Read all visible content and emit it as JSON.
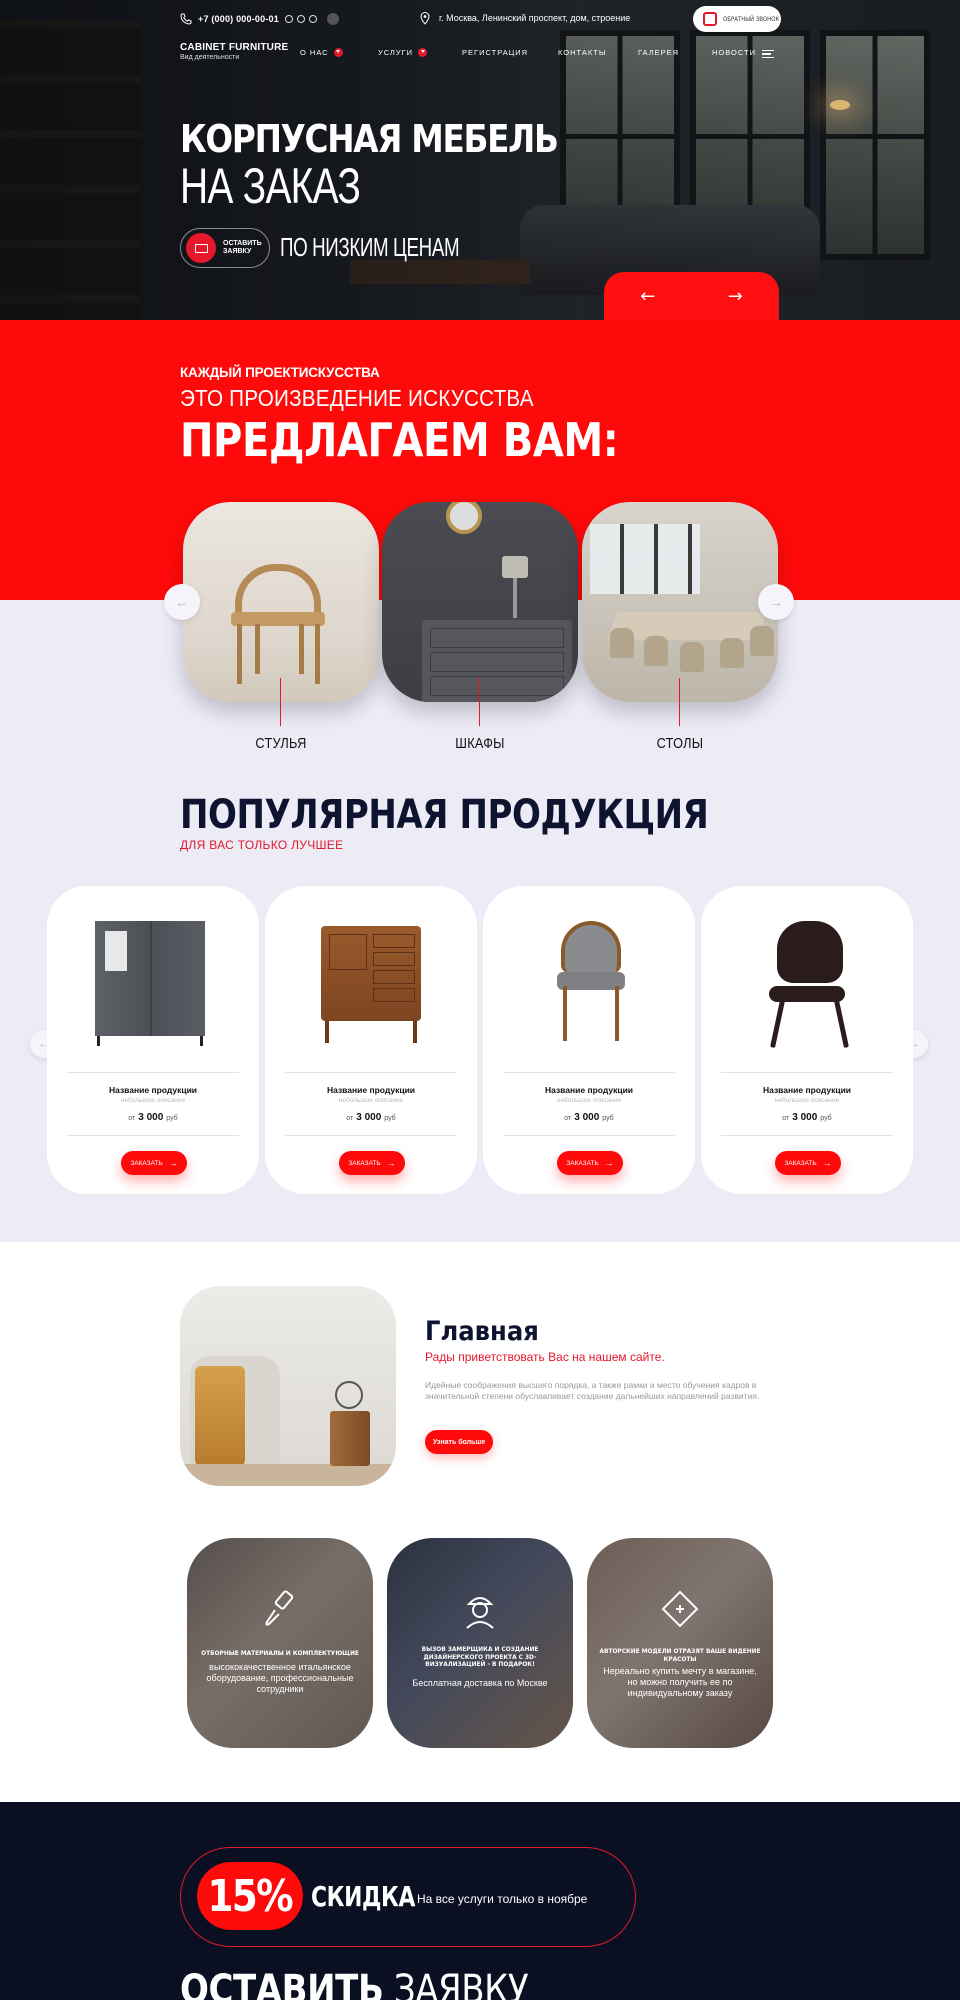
{
  "topbar": {
    "phone": "+7 (000) 000-00-01",
    "address": "г. Москва, Ленинский проспект, дом, строение",
    "callback_label": "ОБРАТНЫЙ ЗВОНОК"
  },
  "logo": {
    "name": "CABINET FURNITURE",
    "tagline": "Вид деятельности"
  },
  "nav": [
    {
      "label": "О НАС",
      "dropdown": true
    },
    {
      "label": "УСЛУГИ",
      "dropdown": true
    },
    {
      "label": "РЕГИСТРАЦИЯ",
      "dropdown": false
    },
    {
      "label": "КОНТАКТЫ",
      "dropdown": false
    },
    {
      "label": "ГАЛЕРЕЯ",
      "dropdown": false
    },
    {
      "label": "НОВОСТИ",
      "dropdown": false
    }
  ],
  "hero": {
    "title_line1": "КОРПУСНАЯ МЕБЕЛЬ",
    "title_line2": "НА ЗАКАЗ",
    "request_button": "ОСТАВИТЬ ЗАЯВКУ",
    "subtitle": "ПО НИЗКИМ ЦЕНАМ",
    "prev_arrow": "←",
    "next_arrow": "→"
  },
  "offer": {
    "kicker": "КАЖДЫЙ ПРОЕКТИСКУССТВА",
    "line2": "ЭТО ПРОИЗВЕДЕНИЕ ИСКУССТВА",
    "title": "ПРЕДЛАГАЕМ ВАМ:",
    "categories": [
      {
        "label": "СТУЛЬЯ"
      },
      {
        "label": "ШКАФЫ"
      },
      {
        "label": "СТОЛЫ"
      }
    ],
    "prev_arrow": "←",
    "next_arrow": "→"
  },
  "popular": {
    "title": "ПОПУЛЯРНАЯ ПРОДУКЦИЯ",
    "subtitle": "ДЛЯ ВАС ТОЛЬКО ЛУЧШЕЕ",
    "prev_arrow": "←",
    "next_arrow": "→",
    "products": [
      {
        "name": "Название продукции",
        "description": "небольшое описание",
        "price_prefix": "от",
        "price": "3 000",
        "currency": "руб",
        "order_label": "ЗАКАЗАТЬ"
      },
      {
        "name": "Название продукции",
        "description": "небольшое описание",
        "price_prefix": "от",
        "price": "3 000",
        "currency": "руб",
        "order_label": "ЗАКАЗАТЬ"
      },
      {
        "name": "Название продукции",
        "description": "небольшое описание",
        "price_prefix": "от",
        "price": "3 000",
        "currency": "руб",
        "order_label": "ЗАКАЗАТЬ"
      },
      {
        "name": "Название продукции",
        "description": "небольшое описание",
        "price_prefix": "от",
        "price": "3 000",
        "currency": "руб",
        "order_label": "ЗАКАЗАТЬ"
      }
    ]
  },
  "about": {
    "title": "Главная",
    "subtitle": "Рады приветствовать Вас на нашем сайте.",
    "text": "Идейные соображения высшего порядка, а также рамки и место обучения кадров в значительной степени обуславливает создание дальнейших направлений развития.",
    "button": "Узнать больше"
  },
  "features": [
    {
      "title": "ОТБОРНЫЕ МАТЕРИАЛЫ И КОМПЛЕКТУЮЩИЕ",
      "description": "высококачественное итальянское оборудование, профессиональные сотрудники",
      "icon": "brush-icon"
    },
    {
      "title": "ВЫЗОВ ЗАМЕРЩИКА И СОЗДАНИЕ ДИЗАЙНЕРСКОГО ПРОЕКТА С 3D-ВИЗУАЛИЗАЦИЕЙ - В ПОДАРОК!",
      "description": "Бесплатная доставка по Москве",
      "icon": "worker-icon"
    },
    {
      "title": "АВТОРСКИЕ МОДЕЛИ ОТРАЗЯТ ВАШЕ ВИДЕНИЕ КРАСОТЫ",
      "description": "Нереально купить мечту в магазине, но можно получить ее по индивидуальному заказу",
      "icon": "ruler-icon"
    }
  ],
  "discount": {
    "percent": "15%",
    "label": "СКИДКА",
    "description": "На все услуги только в ноябре"
  },
  "leave_request": {
    "bold": "ОСТАВИТЬ",
    "rest": "ЗАЯВКУ"
  },
  "colors": {
    "accent": "#ff0a0a",
    "navy": "#0e1430",
    "dark_bg": "#0a0f22",
    "light_bg": "#ecebf6"
  }
}
